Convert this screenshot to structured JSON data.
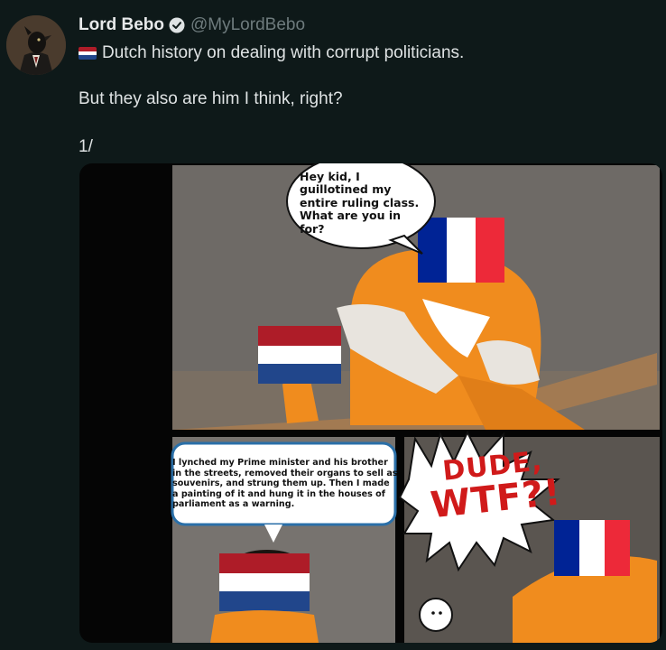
{
  "author": {
    "name": "Lord Bebo",
    "handle": "@MyLordBebo",
    "verified_icon": "verified-badge-icon",
    "avatar_icon": "avatar-bird-in-suit"
  },
  "tweet": {
    "line1": "Dutch history on dealing with corrupt politicians.",
    "line1_flag_icon": "netherlands-flag-emoji",
    "line2": "But they also are him I think, right?",
    "line3": "1/"
  },
  "comic": {
    "bubble1": "Hey kid, I guillotined my entire ruling class. What are you in for?",
    "bubble2": "I lynched my Prime minister and his brother in the streets, removed their organs to sell as souvenirs, and strung them up. Then I made a painting of it and hung it in the houses of parliament as a warning.",
    "exclaim_line1": "DUDE,",
    "exclaim_line2": "WTF?!"
  },
  "colors": {
    "background": "#0e1919",
    "nl_red": "#ae1c28",
    "nl_white": "#ffffff",
    "nl_blue": "#21468b",
    "fr_blue": "#002395",
    "fr_red": "#ed2939",
    "prison_orange": "#f08c1e"
  }
}
